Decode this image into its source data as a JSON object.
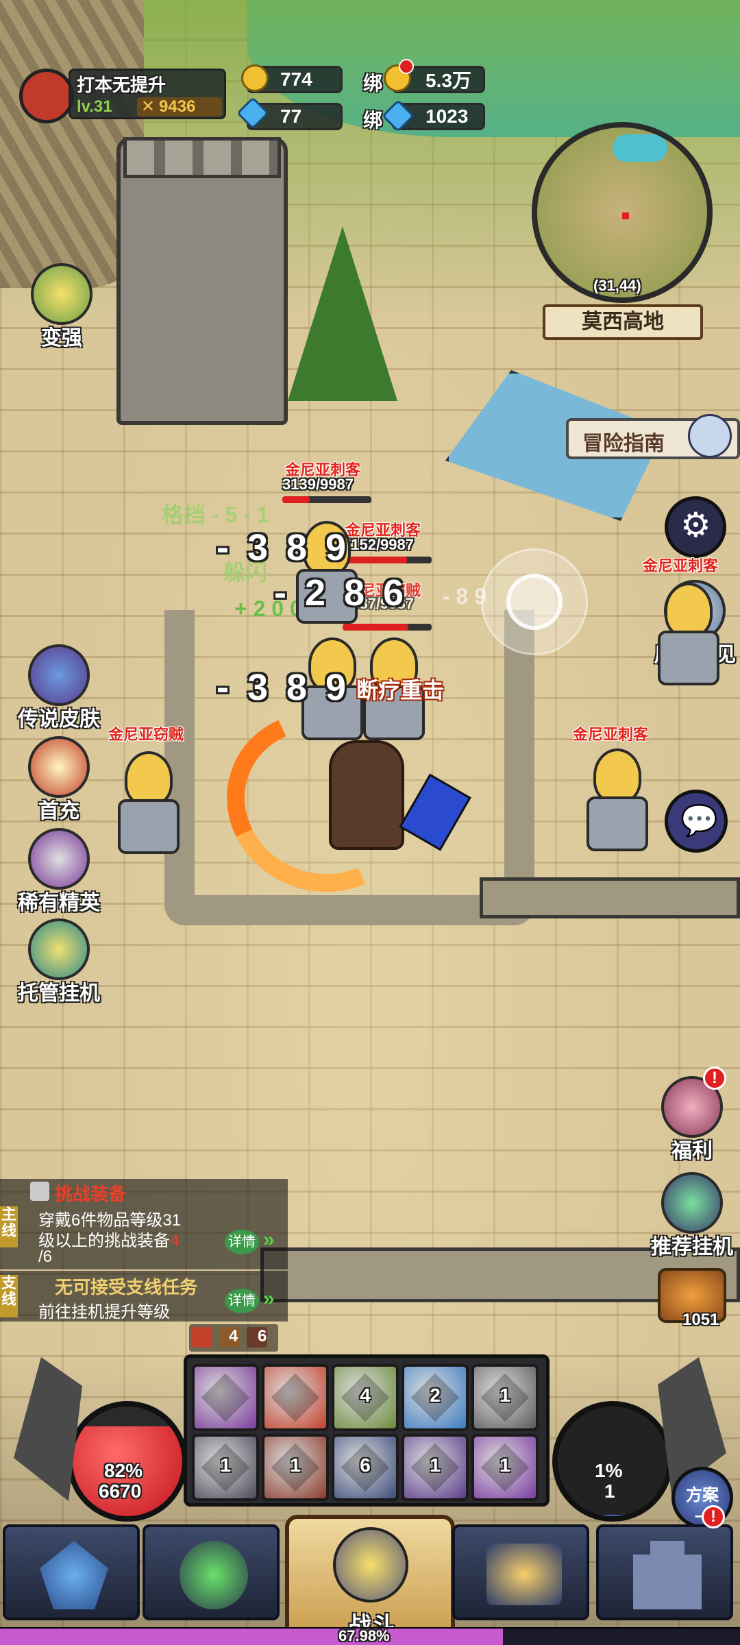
{
  "player": {
    "name": "打本无提升",
    "level": "lv.31",
    "power": "9436"
  },
  "currency": {
    "gold": "774",
    "gems": "77",
    "bound_label": "绑",
    "bound_gold": "5.3万",
    "bound_gems": "1023"
  },
  "minimap": {
    "coords": "(31,44)",
    "location": "莫西高地"
  },
  "guide_label": "冒险指南",
  "left_menu": [
    {
      "label": "变强",
      "icon": "strengthen-icon"
    },
    {
      "label": "传说皮肤",
      "icon": "legendary-skin-icon"
    },
    {
      "label": "首充",
      "icon": "first-recharge-icon"
    },
    {
      "label": "稀有精英",
      "icon": "rare-elite-icon"
    },
    {
      "label": "托管挂机",
      "icon": "auto-idle-icon"
    }
  ],
  "right_menu": {
    "feedback": "反馈意见",
    "welfare": "福利",
    "recommend_idle": "推荐挂机",
    "chest_count": "1051"
  },
  "battle": {
    "block_text": "格挡 - 5 - 1",
    "dodge_text": "躲闪",
    "heal_text": "+ 2 0 0",
    "far_text": "- 8 9",
    "damage": [
      "- 3 8 9",
      "- 2 8 6",
      "- 3 8 9"
    ],
    "skill_name": "断疗重击",
    "enemies": [
      {
        "name": "金尼亚刺客",
        "hp": "3139/9987",
        "hp_pct": 31
      },
      {
        "name": "金尼亚刺客",
        "hp": "7152/9987",
        "hp_pct": 72
      },
      {
        "name": "金尼亚窃贼",
        "hp": "7387/9987",
        "hp_pct": 74
      },
      {
        "name": "金尼亚窃贼",
        "hp": "",
        "hp_pct": 0
      },
      {
        "name": "金尼亚刺客",
        "hp": "",
        "hp_pct": 0
      },
      {
        "name": "金尼亚刺客",
        "hp": "",
        "hp_pct": 0
      }
    ]
  },
  "quests": {
    "main_tag": "主线",
    "main_title": "挑战装备",
    "main_desc_1": "穿戴6件物品等级31",
    "main_desc_2": "级以上的挑战装备",
    "main_progress_cur": "4",
    "main_progress_total": "/6",
    "detail": "详情",
    "side_tag": "支线",
    "side_title": "无可接受支线任务",
    "side_desc": "前往挂机提升等级"
  },
  "buffs": {
    "a": "4",
    "b": "6"
  },
  "skills": [
    {
      "count": "",
      "color": "#7a3a9a"
    },
    {
      "count": "",
      "color": "#c2402a"
    },
    {
      "count": "4",
      "color": "#6a8a3a"
    },
    {
      "count": "2",
      "color": "#3a7ac2"
    },
    {
      "count": "1",
      "color": "#5a5a5a"
    },
    {
      "count": "1",
      "color": "#4a4a5a"
    },
    {
      "count": "1",
      "color": "#8a3a2a"
    },
    {
      "count": "6",
      "color": "#3a4a7a"
    },
    {
      "count": "1",
      "color": "#5a3a8a"
    },
    {
      "count": "1",
      "color": "#7a3aa0"
    }
  ],
  "hp_orb": {
    "pct": "82%",
    "value": "6670",
    "fill": 82
  },
  "mp_orb": {
    "pct": "1%",
    "value": "1",
    "fill": 1
  },
  "plan_button": {
    "label": "方案",
    "num": "一"
  },
  "nav": {
    "battle_label": "战斗"
  },
  "exp": {
    "text": "67.98%",
    "fill": 67.98
  }
}
